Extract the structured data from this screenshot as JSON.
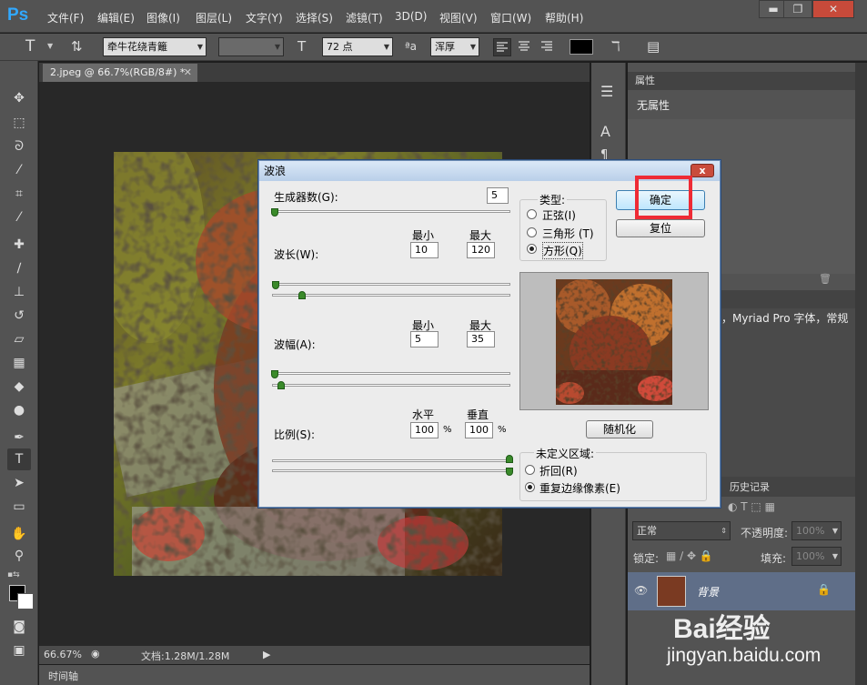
{
  "app": {
    "logo": "Ps"
  },
  "menu": [
    "文件(F)",
    "编辑(E)",
    "图像(I)",
    "图层(L)",
    "文字(Y)",
    "选择(S)",
    "滤镜(T)",
    "3D(D)",
    "视图(V)",
    "窗口(W)",
    "帮助(H)"
  ],
  "window_buttons": {
    "minimize": "▬",
    "restore": "❐",
    "close": "✕"
  },
  "options": {
    "tool_glyph": "T",
    "font_family": "牵牛花绕青籬",
    "font_size": "72 点",
    "aa_label": "ªa",
    "antialias": "浑厚"
  },
  "document": {
    "tab_title": "2.jpeg @ 66.7%(RGB/8#) *",
    "zoom": "66.67%",
    "doc_size": "文档:1.28M/1.28M",
    "timeline": "时间轴"
  },
  "panels": {
    "properties_tab": "属性",
    "properties_text": "无属性",
    "char_note": "，Myriad Pro 字体，常规",
    "history_tab": "历史记录",
    "blend_mode": "正常",
    "opacity_label": "不透明度:",
    "opacity_value": "100%",
    "lock_label": "锁定:",
    "fill_label": "填充:",
    "fill_value": "100%",
    "layer_name": "背景"
  },
  "dialog": {
    "title": "波浪",
    "generators_label": "生成器数(G):",
    "generators_value": "5",
    "wavelength_label": "波长(W):",
    "amplitude_label": "波幅(A):",
    "scale_label": "比例(S):",
    "min_label": "最小",
    "max_label": "最大",
    "wavelength_min": "10",
    "wavelength_max": "120",
    "amplitude_min": "5",
    "amplitude_max": "35",
    "horizontal_label": "水平",
    "vertical_label": "垂直",
    "scale_h": "100",
    "scale_v": "100",
    "percent": "%",
    "type_label": "类型:",
    "type_options": [
      "正弦(I)",
      "三角形 (T)",
      "方形(Q)"
    ],
    "ok_label": "确定",
    "reset_label": "复位",
    "randomize_label": "随机化",
    "undefined_label": "未定义区域:",
    "undefined_options": [
      "折回(R)",
      "重复边缘像素(E)"
    ]
  },
  "watermark": {
    "brand": "Bai经验",
    "url": "jingyan.baidu.com"
  },
  "colors": {
    "ui_dark": "#535353",
    "canvas_bg": "#282828",
    "highlight": "#ee2b35"
  }
}
